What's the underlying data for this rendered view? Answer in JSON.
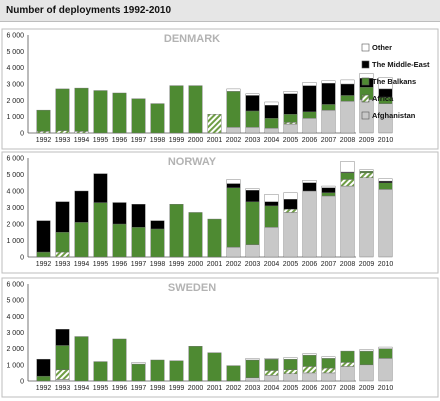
{
  "title": "Number of deployments 1992-2010",
  "colors": {
    "Other": "#ffffff",
    "The Middle-East": "#000000",
    "The Balkans": "#4e8a32",
    "Africa": "#6f9e45",
    "Afghanistan": "#c8c8c8"
  },
  "chart_data": [
    {
      "type": "bar",
      "stacked": true,
      "title": "DENMARK",
      "categories": [
        "1992",
        "1993",
        "1994",
        "1995",
        "1996",
        "1997",
        "1998",
        "1999",
        "2000",
        "2001",
        "2002",
        "2003",
        "2004",
        "2005",
        "2006",
        "2007",
        "2008",
        "2009",
        "2010"
      ],
      "ylim": [
        0,
        6000
      ],
      "yticks": [
        "0",
        "1 000",
        "2 000",
        "3 000",
        "4 000",
        "5 000",
        "6 000"
      ],
      "legend": [
        "Other",
        "The Middle-East",
        "The Balkans",
        "Africa",
        "Afghanistan"
      ],
      "legend_position": "right",
      "series": [
        {
          "name": "Afghanistan",
          "values": [
            0,
            0,
            0,
            0,
            0,
            0,
            0,
            0,
            0,
            0,
            350,
            350,
            300,
            550,
            900,
            1400,
            1950,
            2050,
            1800
          ]
        },
        {
          "name": "Africa",
          "values": [
            100,
            150,
            100,
            0,
            0,
            0,
            0,
            0,
            0,
            1150,
            0,
            0,
            0,
            100,
            0,
            0,
            0,
            0,
            0
          ]
        },
        {
          "name": "The Balkans",
          "values": [
            1300,
            2550,
            2650,
            2600,
            2450,
            2100,
            1800,
            2900,
            2900,
            0,
            2200,
            1000,
            600,
            500,
            400,
            350,
            350,
            750,
            400
          ]
        },
        {
          "name": "The Middle-East",
          "values": [
            0,
            0,
            0,
            0,
            0,
            0,
            0,
            0,
            0,
            0,
            0,
            950,
            800,
            1250,
            1600,
            1300,
            700,
            550,
            500
          ]
        },
        {
          "name": "Other",
          "values": [
            0,
            0,
            0,
            0,
            0,
            0,
            0,
            0,
            0,
            0,
            150,
            100,
            200,
            150,
            200,
            150,
            250,
            300,
            700
          ]
        }
      ]
    },
    {
      "type": "bar",
      "stacked": true,
      "title": "NORWAY",
      "categories": [
        "1992",
        "1993",
        "1994",
        "1995",
        "1996",
        "1997",
        "1998",
        "1999",
        "2000",
        "2001",
        "2002",
        "2003",
        "2004",
        "2005",
        "2006",
        "2007",
        "2008",
        "2009",
        "2010"
      ],
      "ylim": [
        0,
        6000
      ],
      "yticks": [
        "0",
        "1 000",
        "2 000",
        "3 000",
        "4 000",
        "5 000",
        "6 000"
      ],
      "series": [
        {
          "name": "Afghanistan",
          "values": [
            0,
            0,
            0,
            0,
            0,
            0,
            0,
            0,
            0,
            0,
            600,
            750,
            1800,
            2700,
            4000,
            3700,
            4300,
            4800,
            4100
          ]
        },
        {
          "name": "Africa",
          "values": [
            0,
            300,
            0,
            0,
            0,
            0,
            0,
            0,
            0,
            0,
            0,
            0,
            0,
            200,
            0,
            0,
            400,
            300,
            0
          ]
        },
        {
          "name": "The Balkans",
          "values": [
            300,
            1200,
            2100,
            3300,
            2000,
            1800,
            1700,
            3200,
            2700,
            2300,
            3600,
            2600,
            1300,
            0,
            0,
            200,
            400,
            100,
            400
          ]
        },
        {
          "name": "The Middle-East",
          "values": [
            1900,
            1850,
            1900,
            1750,
            1300,
            1400,
            500,
            0,
            0,
            0,
            250,
            700,
            250,
            600,
            500,
            300,
            50,
            0,
            100
          ]
        },
        {
          "name": "Other",
          "values": [
            0,
            0,
            0,
            0,
            0,
            0,
            0,
            0,
            0,
            0,
            250,
            100,
            450,
            400,
            150,
            100,
            650,
            100,
            150
          ]
        }
      ]
    },
    {
      "type": "bar",
      "stacked": true,
      "title": "SWEDEN",
      "categories": [
        "1992",
        "1993",
        "1994",
        "1995",
        "1996",
        "1997",
        "1998",
        "1999",
        "2000",
        "2001",
        "2002",
        "2003",
        "2004",
        "2005",
        "2006",
        "2007",
        "2008",
        "2009",
        "2010"
      ],
      "ylim": [
        0,
        6000
      ],
      "yticks": [
        "0",
        "1 000",
        "2 000",
        "3 000",
        "4 000",
        "5 000",
        "6 000"
      ],
      "series": [
        {
          "name": "Afghanistan",
          "values": [
            0,
            100,
            0,
            0,
            0,
            0,
            0,
            0,
            0,
            0,
            0,
            200,
            350,
            450,
            500,
            500,
            900,
            1000,
            1400
          ]
        },
        {
          "name": "Africa",
          "values": [
            0,
            600,
            0,
            0,
            0,
            0,
            0,
            0,
            0,
            0,
            0,
            0,
            300,
            250,
            400,
            300,
            250,
            0,
            0
          ]
        },
        {
          "name": "The Balkans",
          "values": [
            300,
            1500,
            2750,
            1200,
            2600,
            1050,
            1300,
            1250,
            2150,
            1750,
            950,
            1100,
            700,
            650,
            700,
            600,
            700,
            850,
            600
          ]
        },
        {
          "name": "The Middle-East",
          "values": [
            1050,
            1000,
            0,
            0,
            0,
            0,
            0,
            0,
            0,
            0,
            0,
            0,
            0,
            0,
            0,
            0,
            0,
            0,
            0
          ]
        },
        {
          "name": "Other",
          "values": [
            0,
            0,
            0,
            0,
            0,
            100,
            0,
            0,
            0,
            0,
            0,
            100,
            50,
            100,
            100,
            100,
            0,
            100,
            100
          ]
        }
      ]
    }
  ]
}
